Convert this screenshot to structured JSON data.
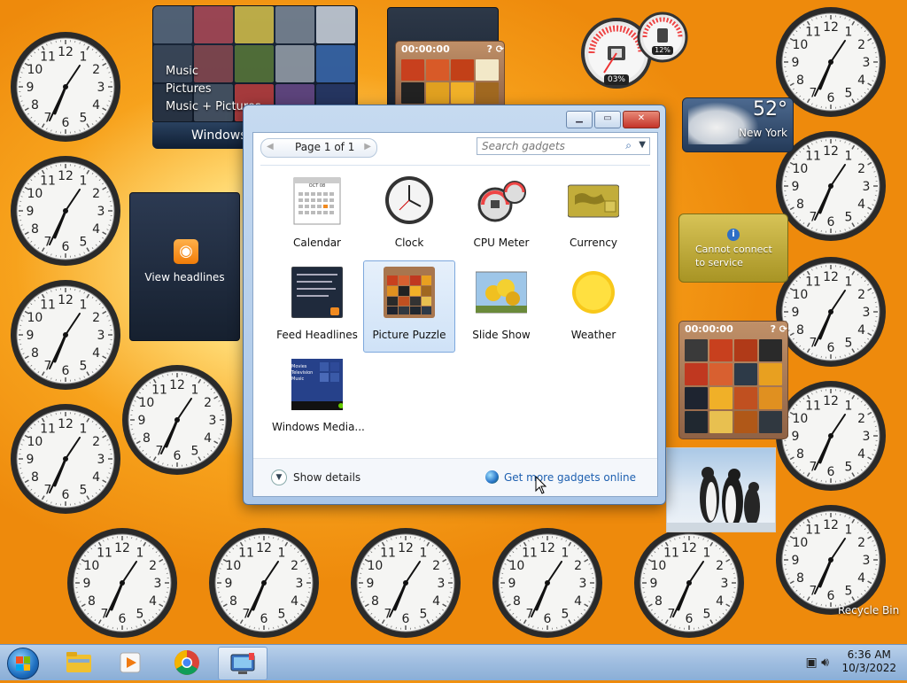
{
  "desktop": {
    "media_center": {
      "menu": [
        "Music",
        "Pictures",
        "Music + Pictures"
      ],
      "bar_label": "Windows"
    },
    "puzzle_top": {
      "timer": "00:00:00"
    },
    "puzzle_right": {
      "timer": "00:00:00"
    },
    "cpu_meter": {
      "cpu": "03%",
      "memory": "12%"
    },
    "weather": {
      "temperature": "52°",
      "city": "New York"
    },
    "currency": {
      "info_icon": "i",
      "message_line1": "Cannot connect",
      "message_line2": "to service"
    },
    "feed": {
      "label": "View headlines"
    },
    "recycle_bin": {
      "label": "Recycle Bin"
    }
  },
  "dialog": {
    "page_label": "Page 1 of 1",
    "search_placeholder": "Search gadgets",
    "gadgets": [
      {
        "name": "Calendar",
        "icon": "calendar-icon",
        "calendar_month": "OCT 08"
      },
      {
        "name": "Clock",
        "icon": "clock-icon"
      },
      {
        "name": "CPU Meter",
        "icon": "cpu-meter-icon"
      },
      {
        "name": "Currency",
        "icon": "currency-icon"
      },
      {
        "name": "Feed Headlines",
        "icon": "feed-icon"
      },
      {
        "name": "Picture Puzzle",
        "icon": "puzzle-icon",
        "selected": true
      },
      {
        "name": "Slide Show",
        "icon": "slideshow-icon"
      },
      {
        "name": "Weather",
        "icon": "weather-icon"
      },
      {
        "name": "Windows Media...",
        "icon": "media-center-icon",
        "thumb_lines": [
          "Movies",
          "Television",
          "Music"
        ]
      }
    ],
    "show_details": "Show details",
    "get_more": "Get more gadgets online"
  },
  "taskbar": {
    "time": "6:36 AM",
    "date": "10/3/2022"
  },
  "colors": {
    "accent": "#1e60b0",
    "selection": "#cfe2f7",
    "desktop_orange": "#f7a21c"
  }
}
